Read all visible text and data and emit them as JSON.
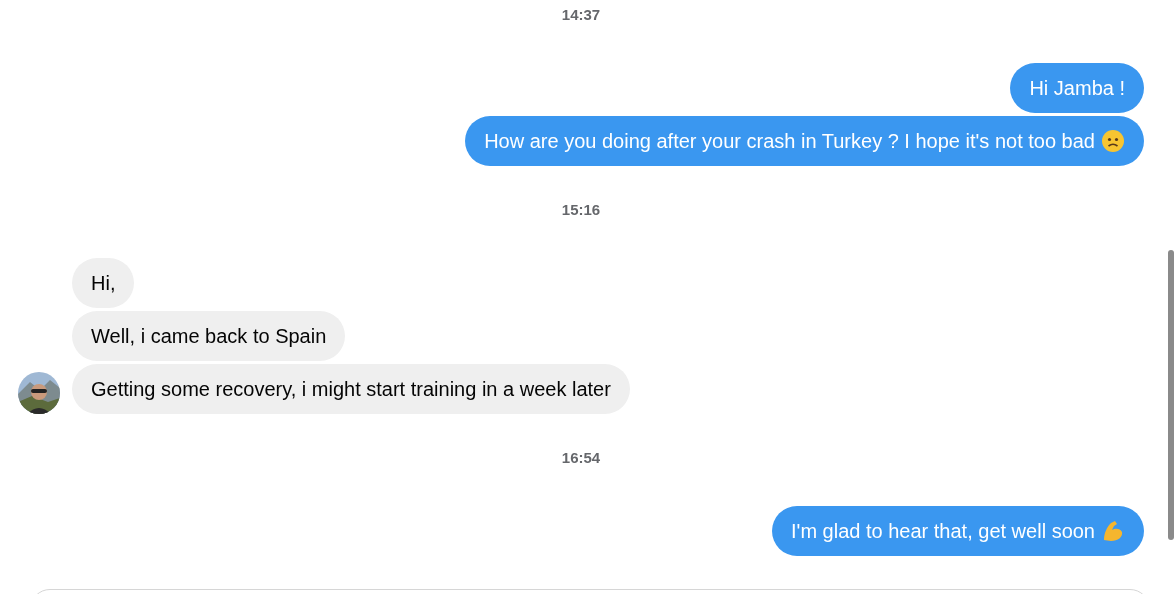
{
  "conversation": [
    {
      "kind": "time",
      "text": "14:37"
    },
    {
      "kind": "sent",
      "messages": [
        {
          "text": "Hi Jamba !"
        },
        {
          "text": "How are you doing after your crash in Turkey ? I hope it's not too bad",
          "icon": {
            "kind": "frown"
          }
        }
      ]
    },
    {
      "kind": "time",
      "text": "15:16"
    },
    {
      "kind": "received",
      "messages": [
        {
          "text": "Hi,"
        },
        {
          "text": "Well, i came back to Spain"
        },
        {
          "text": "Getting some recovery, i might start training in a week later"
        }
      ]
    },
    {
      "kind": "time",
      "text": "16:54"
    },
    {
      "kind": "sent",
      "messages": [
        {
          "text": "I'm glad to hear that, get well soon",
          "icon": {
            "kind": "muscle"
          }
        }
      ]
    }
  ]
}
